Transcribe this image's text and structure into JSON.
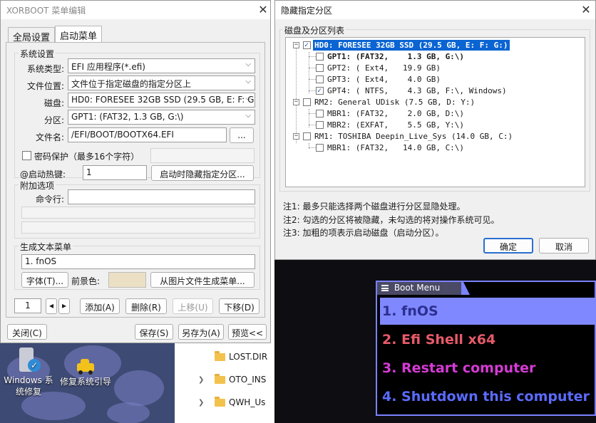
{
  "left_window": {
    "title": "XORBOOT 菜单编辑",
    "tabs": [
      {
        "label": "全局设置"
      },
      {
        "label": "启动菜单"
      }
    ],
    "system_settings": {
      "group_label": "系统设置",
      "system_type_label": "系统类型:",
      "system_type_value": "EFI 应用程序(*.efi)",
      "file_location_label": "文件位置:",
      "file_location_value": "文件位于指定磁盘的指定分区上",
      "disk_label": "磁盘:",
      "disk_value": "HD0: FORESEE 32GB SSD (29.5 GB, E: F: G:)",
      "partition_label": "分区:",
      "partition_value": "GPT1: (FAT32,   1.3 GB, G:\\)",
      "filename_label": "文件名:",
      "filename_value": "/EFI/BOOT/BOOTX64.EFI",
      "browse_label": "...",
      "password_label": "密码保护（最多16个字符）",
      "hotkey_label": "@启动热键:",
      "hotkey_value": "1",
      "hide_partition_button": "启动时隐藏指定分区..."
    },
    "extra_options": {
      "group_label": "附加选项",
      "cmdline_label": "命令行:"
    },
    "text_menu": {
      "group_label": "生成文本菜单",
      "current_item": "1.  fnOS",
      "font_button": "字体(T)...",
      "foreground_label": "前景色:",
      "from_image_button": "从图片文件生成菜单..."
    },
    "list_controls": {
      "index_value": "1",
      "add": "添加(A)",
      "delete": "删除(R)",
      "move_up": "上移(U)",
      "move_down": "下移(D)"
    },
    "footer": {
      "close": "关闭(C)",
      "save": "保存(S)",
      "save_as": "另存为(A)",
      "preview": "预览<<"
    }
  },
  "right_window": {
    "title": "隐藏指定分区",
    "list_label": "磁盘及分区列表",
    "tree": [
      {
        "text": "HD0: FORESEE 32GB SSD (29.5 GB, E: F: G:)",
        "checked": true,
        "selected": true,
        "bold": true
      },
      {
        "text": "GPT1: (FAT32,    1.3 GB, G:\\)",
        "checked": false,
        "bold": true
      },
      {
        "text": "GPT2: ( Ext4,   19.9 GB)",
        "checked": false
      },
      {
        "text": "GPT3: ( Ext4,    4.0 GB)",
        "checked": false
      },
      {
        "text": "GPT4: ( NTFS,    4.3 GB, F:\\, Windows)",
        "checked": true
      },
      {
        "text": "RM2: General UDisk (7.5 GB, D: Y:)",
        "checked": false
      },
      {
        "text": "MBR1: (FAT32,    2.0 GB, D:\\)",
        "checked": false
      },
      {
        "text": "MBR2: (EXFAT,    5.5 GB, Y:\\)",
        "checked": false
      },
      {
        "text": "RM1: TOSHIBA Deepin_Live_Sys (14.0 GB, C:)",
        "checked": false
      },
      {
        "text": "MBR1: (FAT32,   14.0 GB, C:\\)",
        "checked": false
      }
    ],
    "notes": [
      "注1: 最多只能选择两个磁盘进行分区显隐处理。",
      "注2: 勾选的分区将被隐藏，未勾选的将对操作系统可见。",
      "注3: 加粗的项表示启动磁盘（启动分区）。"
    ],
    "ok": "确定",
    "cancel": "取消"
  },
  "boot_preview": {
    "tab_label": "Boot Menu",
    "items": [
      {
        "label": "1.  fnOS",
        "color": "#2b2f8f"
      },
      {
        "label": "2.  Efi Shell x64",
        "color": "#e85a6a"
      },
      {
        "label": "3.  Restart computer",
        "color": "#d63bd6"
      },
      {
        "label": "4.  Shutdown this computer",
        "color": "#5a6bff"
      }
    ],
    "highlight_color": "#8088ff"
  },
  "desktop": {
    "icons": [
      {
        "label": "Windows 系统修复",
        "icon": "shield-check-icon"
      },
      {
        "label": "修复系统引导",
        "icon": "repair-car-icon"
      }
    ],
    "explorer_items": [
      {
        "label": "LOST.DIR"
      },
      {
        "label": "OTO_INS"
      },
      {
        "label": "QWH_Us"
      }
    ]
  }
}
